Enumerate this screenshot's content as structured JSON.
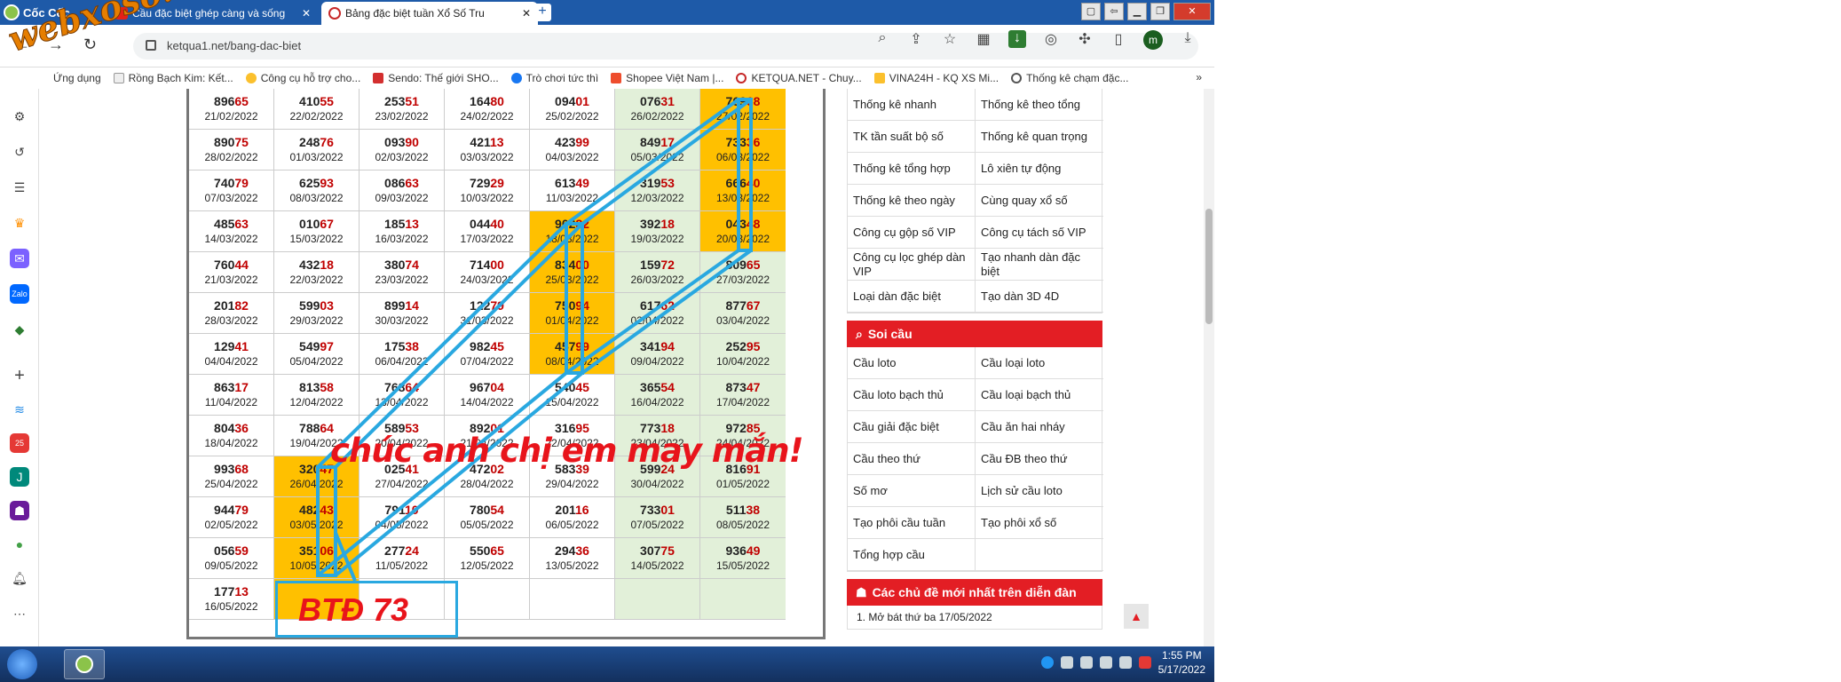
{
  "browser": {
    "brand": "Cốc Cốc",
    "tabs": [
      {
        "label": "Cầu đặc biệt ghép càng và sống",
        "icon": "youtube-icon"
      },
      {
        "label": "Bảng đặc biệt tuần Xổ Số Tru",
        "icon": "ketqua-icon"
      }
    ],
    "url": "ketqua1.net/bang-dac-biet",
    "bookmarks": [
      "Ứng dụng",
      "Rồng Bạch Kim: Kết...",
      "Công cụ hỗ trợ cho...",
      "Sendo: Thế giới SHO...",
      "Trò chơi tức thì",
      "Shopee Việt Nam |...",
      "KETQUA.NET - Chuy...",
      "VINA24H - KQ XS Mi...",
      "Thống kê chạm đặc..."
    ],
    "avatar_letter": "m"
  },
  "watermark": "webxoso.net",
  "table": {
    "rows": [
      [
        {
          "num": "89665",
          "date": "21/02/2022"
        },
        {
          "num": "41055",
          "date": "22/02/2022"
        },
        {
          "num": "25351",
          "date": "23/02/2022"
        },
        {
          "num": "16480",
          "date": "24/02/2022"
        },
        {
          "num": "09401",
          "date": "25/02/2022"
        },
        {
          "num": "07631",
          "date": "26/02/2022"
        },
        {
          "num": "76968",
          "date": "27/02/2022"
        }
      ],
      [
        {
          "num": "89075",
          "date": "28/02/2022"
        },
        {
          "num": "24876",
          "date": "01/03/2022"
        },
        {
          "num": "09390",
          "date": "02/03/2022"
        },
        {
          "num": "42113",
          "date": "03/03/2022"
        },
        {
          "num": "42399",
          "date": "04/03/2022"
        },
        {
          "num": "84917",
          "date": "05/03/2022"
        },
        {
          "num": "73336",
          "date": "06/03/2022"
        }
      ],
      [
        {
          "num": "74079",
          "date": "07/03/2022"
        },
        {
          "num": "62593",
          "date": "08/03/2022"
        },
        {
          "num": "08663",
          "date": "09/03/2022"
        },
        {
          "num": "72929",
          "date": "10/03/2022"
        },
        {
          "num": "61349",
          "date": "11/03/2022"
        },
        {
          "num": "31953",
          "date": "12/03/2022"
        },
        {
          "num": "66640",
          "date": "13/03/2022"
        }
      ],
      [
        {
          "num": "48563",
          "date": "14/03/2022"
        },
        {
          "num": "01067",
          "date": "15/03/2022"
        },
        {
          "num": "18513",
          "date": "16/03/2022"
        },
        {
          "num": "04440",
          "date": "17/03/2022"
        },
        {
          "num": "90282",
          "date": "18/03/2022"
        },
        {
          "num": "39218",
          "date": "19/03/2022"
        },
        {
          "num": "04348",
          "date": "20/03/2022"
        }
      ],
      [
        {
          "num": "76044",
          "date": "21/03/2022"
        },
        {
          "num": "43218",
          "date": "22/03/2022"
        },
        {
          "num": "38074",
          "date": "23/03/2022"
        },
        {
          "num": "71400",
          "date": "24/03/2022"
        },
        {
          "num": "83400",
          "date": "25/03/2022"
        },
        {
          "num": "15972",
          "date": "26/03/2022"
        },
        {
          "num": "80965",
          "date": "27/03/2022"
        }
      ],
      [
        {
          "num": "20182",
          "date": "28/03/2022"
        },
        {
          "num": "59903",
          "date": "29/03/2022"
        },
        {
          "num": "89914",
          "date": "30/03/2022"
        },
        {
          "num": "12279",
          "date": "31/03/2022"
        },
        {
          "num": "75094",
          "date": "01/04/2022"
        },
        {
          "num": "61762",
          "date": "02/04/2022"
        },
        {
          "num": "87767",
          "date": "03/04/2022"
        }
      ],
      [
        {
          "num": "12941",
          "date": "04/04/2022"
        },
        {
          "num": "54997",
          "date": "05/04/2022"
        },
        {
          "num": "17538",
          "date": "06/04/2022"
        },
        {
          "num": "98245",
          "date": "07/04/2022"
        },
        {
          "num": "45799",
          "date": "08/04/2022"
        },
        {
          "num": "34194",
          "date": "09/04/2022"
        },
        {
          "num": "25295",
          "date": "10/04/2022"
        }
      ],
      [
        {
          "num": "86317",
          "date": "11/04/2022"
        },
        {
          "num": "81358",
          "date": "12/04/2022"
        },
        {
          "num": "76864",
          "date": "13/04/2022"
        },
        {
          "num": "96704",
          "date": "14/04/2022"
        },
        {
          "num": "54045",
          "date": "15/04/2022"
        },
        {
          "num": "36554",
          "date": "16/04/2022"
        },
        {
          "num": "87347",
          "date": "17/04/2022"
        }
      ],
      [
        {
          "num": "80436",
          "date": "18/04/2022"
        },
        {
          "num": "78864",
          "date": "19/04/2022"
        },
        {
          "num": "58953",
          "date": "20/04/2022"
        },
        {
          "num": "89201",
          "date": "21/04/2022"
        },
        {
          "num": "31695",
          "date": "22/04/2022"
        },
        {
          "num": "77318",
          "date": "23/04/2022"
        },
        {
          "num": "97285",
          "date": "24/04/2022"
        }
      ],
      [
        {
          "num": "99368",
          "date": "25/04/2022"
        },
        {
          "num": "32047",
          "date": "26/04/2022"
        },
        {
          "num": "02541",
          "date": "27/04/2022"
        },
        {
          "num": "47202",
          "date": "28/04/2022"
        },
        {
          "num": "58339",
          "date": "29/04/2022"
        },
        {
          "num": "59924",
          "date": "30/04/2022"
        },
        {
          "num": "81691",
          "date": "01/05/2022"
        }
      ],
      [
        {
          "num": "94479",
          "date": "02/05/2022"
        },
        {
          "num": "48243",
          "date": "03/05/2022"
        },
        {
          "num": "79110",
          "date": "04/05/2022"
        },
        {
          "num": "78054",
          "date": "05/05/2022"
        },
        {
          "num": "20116",
          "date": "06/05/2022"
        },
        {
          "num": "73301",
          "date": "07/05/2022"
        },
        {
          "num": "51138",
          "date": "08/05/2022"
        }
      ],
      [
        {
          "num": "05659",
          "date": "09/05/2022"
        },
        {
          "num": "35106",
          "date": "10/05/2022"
        },
        {
          "num": "27724",
          "date": "11/05/2022"
        },
        {
          "num": "55065",
          "date": "12/05/2022"
        },
        {
          "num": "29436",
          "date": "13/05/2022"
        },
        {
          "num": "30775",
          "date": "14/05/2022"
        },
        {
          "num": "93649",
          "date": "15/05/2022"
        }
      ],
      [
        {
          "num": "17713",
          "date": "16/05/2022"
        },
        {
          "num": "",
          "date": ""
        },
        {
          "num": "",
          "date": ""
        },
        {
          "num": "",
          "date": ""
        },
        {
          "num": "",
          "date": ""
        },
        {
          "num": "",
          "date": ""
        },
        {
          "num": "",
          "date": ""
        }
      ]
    ],
    "orange_cells": [
      [
        0,
        6
      ],
      [
        1,
        6
      ],
      [
        2,
        6
      ],
      [
        3,
        6
      ],
      [
        3,
        4
      ],
      [
        4,
        4
      ],
      [
        5,
        4
      ],
      [
        6,
        4
      ],
      [
        9,
        1
      ],
      [
        10,
        1
      ],
      [
        11,
        1
      ],
      [
        12,
        1
      ]
    ]
  },
  "overlay": {
    "blessing": "chúc anh chị em may mắn!",
    "btd": "BTĐ 73",
    "line_color": "#29a8e0",
    "text_color": "#e8141b"
  },
  "right_panel": {
    "stats_links": [
      "Thống kê nhanh",
      "Thống kê theo tổng",
      "TK tần suất bộ số",
      "Thống kê quan trọng",
      "Thống kê tổng hợp",
      "Lô xiên tự động",
      "Thống kê theo ngày",
      "Cùng quay xổ số",
      "Công cụ gộp số VIP",
      "Công cụ tách số VIP",
      "Công cụ lọc ghép dàn VIP",
      "Tạo nhanh dàn đặc biệt",
      "Loại dàn đặc biệt",
      "Tạo dàn 3D 4D"
    ],
    "soi_cau_title": "Soi cầu",
    "soi_cau_links": [
      "Cầu loto",
      "Cầu loại loto",
      "Cầu loto bạch thủ",
      "Cầu loại bạch thủ",
      "Cầu giải đặc biệt",
      "Cầu ăn hai nháy",
      "Cầu theo thứ",
      "Cầu ĐB theo thứ",
      "Số mơ",
      "Lịch sử cầu loto",
      "Tạo phôi cầu tuần",
      "Tạo phôi xổ số",
      "Tổng hợp cầu",
      ""
    ],
    "forum_title": "Các chủ đề mới nhất trên diễn đàn",
    "forum_items": [
      "1. Mở bát thứ ba 17/05/2022"
    ]
  },
  "taskbar": {
    "time": "1:55 PM",
    "date": "5/17/2022"
  },
  "colors": {
    "tab_bar": "#1e5aa8",
    "green_cell": "#e2f0d9",
    "orange_cell": "#ffc000",
    "red_header": "#e31e24"
  }
}
